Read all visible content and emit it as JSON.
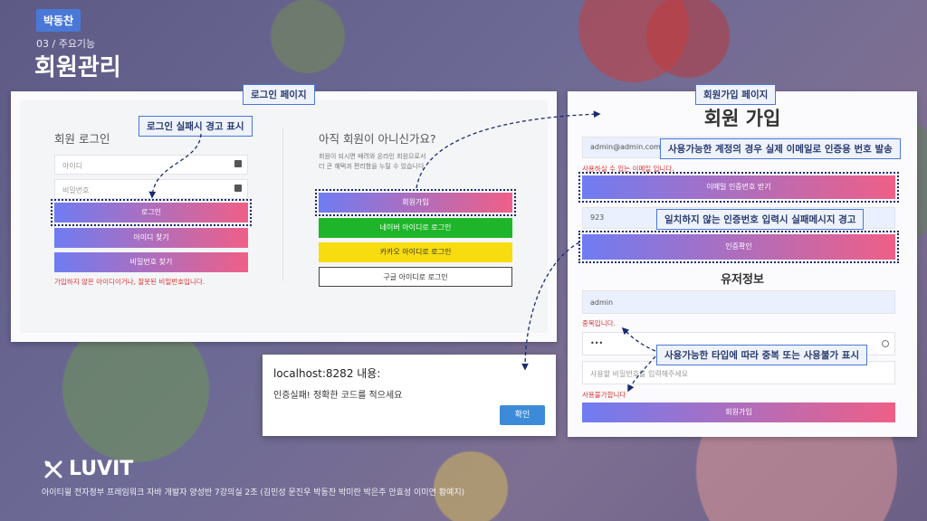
{
  "header": {
    "author_tag": "박동찬",
    "subtitle": "03 / 주요기능",
    "title": "회원관리"
  },
  "callouts": {
    "login_page": "로그인 페이지",
    "login_fail_warning": "로그인 실패시 경고 표시",
    "signup_page": "회원가입 페이지",
    "email_verification": "사용가능한 계정의 경우 실제 이메일로 인증용 번호 발송",
    "code_mismatch": "일치하지 않는 인증번호 입력시 실패메시지 경고",
    "duplicate_check": "사용가능한 타입에 따라 중복 또는 사용불가 표시"
  },
  "login": {
    "heading": "회원 로그인",
    "id_placeholder": "아이디",
    "pw_placeholder": "비밀번호",
    "login_button": "로그인",
    "find_id_button": "아이디 찾기",
    "find_pw_button": "비밀번호 찾기",
    "error_text": "가입하지 않은 아이디이거나, 잘못된 비밀번호입니다.",
    "not_member_heading": "아직 회원이 아니신가요?",
    "not_member_desc_1": "회원이 되시면 배려와 온라인 회원으로서",
    "not_member_desc_2": "더 큰 혜택과 편리함을 누릴 수 있습니다.",
    "signup_button": "회원가입",
    "naver_button": "네이버 아이디로 로그인",
    "kakao_button": "카카오 아이디로 로그인",
    "google_button": "구글 아이디로 로그인",
    "colors": {
      "naver": "#1fb52a",
      "kakao": "#f7dd10"
    }
  },
  "signup": {
    "heading": "회원 가입",
    "email_value": "admin@admin.com",
    "email_ok_text": "사용하실 수 있는 이메일 입니다.",
    "send_code_button": "이메일 인증번호 받기",
    "code_value": "923",
    "verify_button": "인증확인",
    "user_info_heading": "유저정보",
    "username_value": "admin",
    "duplicate_text": "중복입니다.",
    "password_value": "•••",
    "password_confirm_placeholder": "사용할 비밀번호를 입력해주세요",
    "unavailable_text": "사용불가합니다",
    "submit_button": "회원가입"
  },
  "dialog": {
    "title": "localhost:8282 내용:",
    "message": "인증실패! 정확한 코드를 적으세요",
    "ok_button": "확인"
  },
  "footer": {
    "brand": "LUVIT",
    "credits": "아이티윌 전자정부 프레임워크 자바 개발자 양성반 7강의실 2조 (김민성 문진우 박동찬 박미란 박은주 안효성 이미연 황예지)"
  }
}
